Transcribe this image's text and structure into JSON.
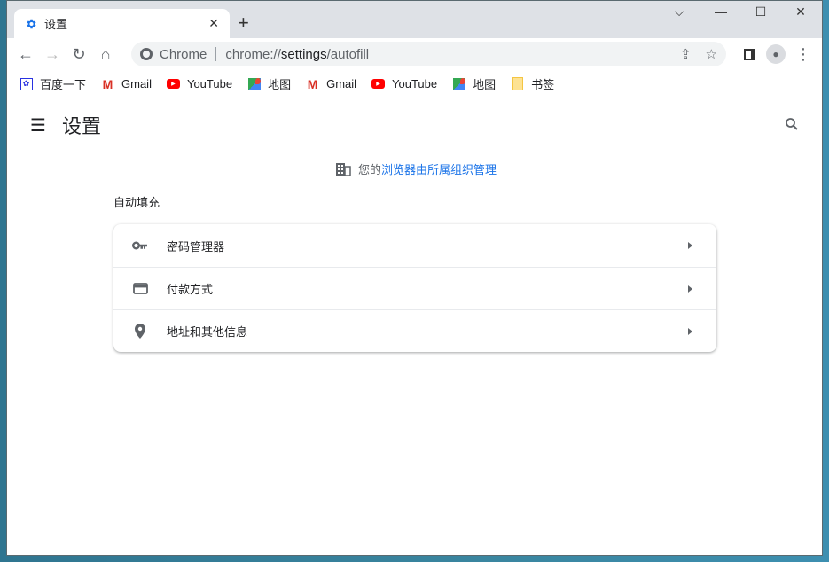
{
  "tab": {
    "title": "设置",
    "icon": "gear-icon",
    "accent": "#1a73e8"
  },
  "omnibox": {
    "site": "Chrome",
    "url_prefix": "chrome://",
    "url_host": "settings",
    "url_path": "/autofill"
  },
  "bookmarks": [
    {
      "label": "百度一下",
      "icon": "baidu-icon"
    },
    {
      "label": "Gmail",
      "icon": "gmail-icon"
    },
    {
      "label": "YouTube",
      "icon": "youtube-icon"
    },
    {
      "label": "地图",
      "icon": "maps-icon"
    },
    {
      "label": "Gmail",
      "icon": "gmail-icon"
    },
    {
      "label": "YouTube",
      "icon": "youtube-icon"
    },
    {
      "label": "地图",
      "icon": "maps-icon"
    },
    {
      "label": "书签",
      "icon": "folder-icon"
    }
  ],
  "header": {
    "title": "设置"
  },
  "managed": {
    "prefix": "您的",
    "link": "浏览器由所属组织管理",
    "link_color": "#1a73e8"
  },
  "section": {
    "title": "自动填充"
  },
  "items": [
    {
      "label": "密码管理器",
      "icon": "key-icon"
    },
    {
      "label": "付款方式",
      "icon": "credit-card-icon"
    },
    {
      "label": "地址和其他信息",
      "icon": "location-pin-icon"
    }
  ]
}
